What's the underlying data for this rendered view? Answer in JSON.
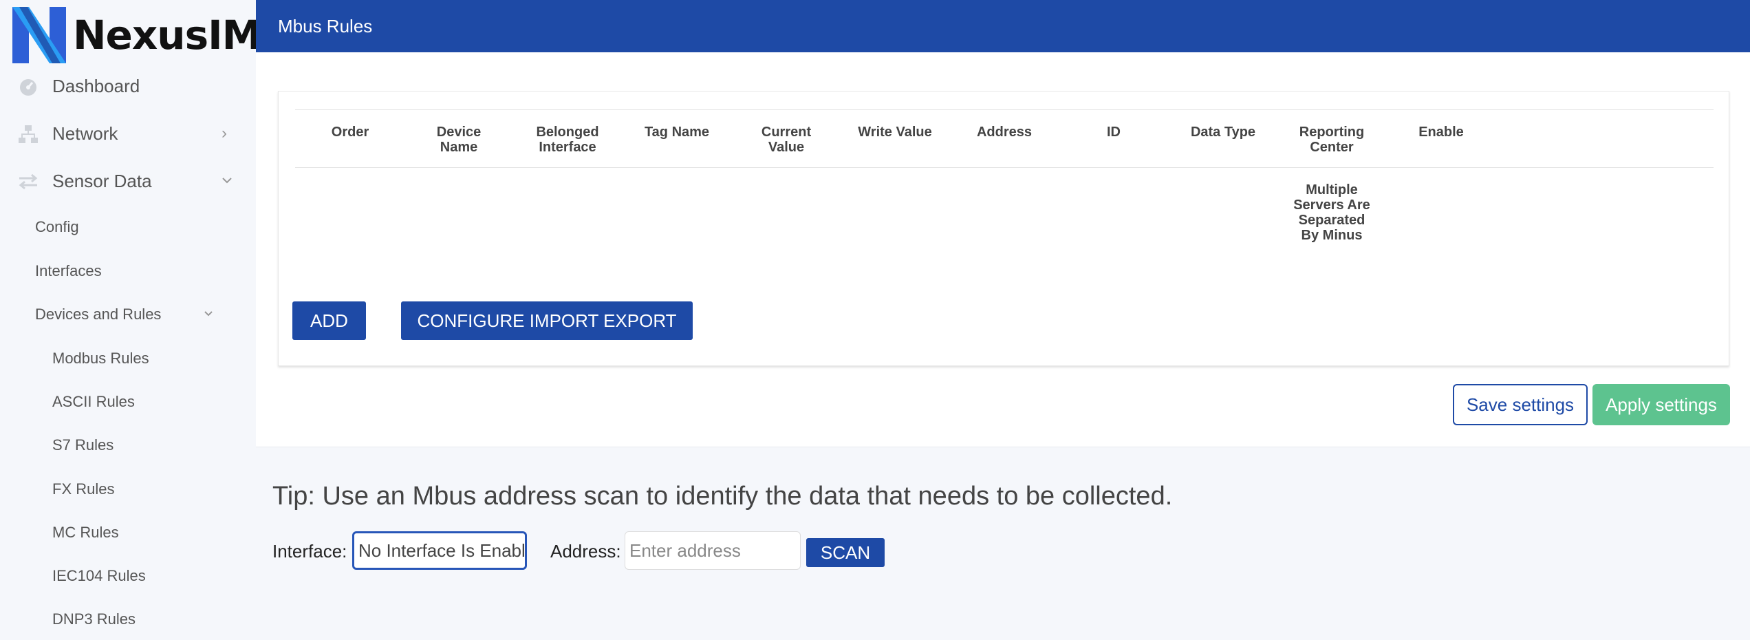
{
  "brand": {
    "name": "NexusIM"
  },
  "sidebar": {
    "items": [
      {
        "label": "Dashboard",
        "icon": "dashboard-icon"
      },
      {
        "label": "Network",
        "icon": "network-icon"
      },
      {
        "label": "Sensor Data",
        "icon": "arrows-icon"
      }
    ],
    "sensor_sub": [
      {
        "label": "Config"
      },
      {
        "label": "Interfaces"
      },
      {
        "label": "Devices and Rules"
      }
    ],
    "rules": [
      {
        "label": "Modbus Rules"
      },
      {
        "label": "ASCII Rules"
      },
      {
        "label": "S7 Rules"
      },
      {
        "label": "FX Rules"
      },
      {
        "label": "MC Rules"
      },
      {
        "label": "IEC104 Rules"
      },
      {
        "label": "DNP3 Rules"
      }
    ]
  },
  "header": {
    "title": "Mbus Rules"
  },
  "table": {
    "columns": [
      {
        "line1": "Order",
        "line2": ""
      },
      {
        "line1": "Device",
        "line2": "Name"
      },
      {
        "line1": "Belonged",
        "line2": "Interface"
      },
      {
        "line1": "Tag Name",
        "line2": ""
      },
      {
        "line1": "Current",
        "line2": "Value"
      },
      {
        "line1": "Write Value",
        "line2": ""
      },
      {
        "line1": "Address",
        "line2": ""
      },
      {
        "line1": "ID",
        "line2": ""
      },
      {
        "line1": "Data Type",
        "line2": ""
      },
      {
        "line1": "Reporting",
        "line2": "Center"
      },
      {
        "line1": "Enable",
        "line2": ""
      }
    ],
    "note_lines": [
      "Multiple",
      "Servers Are",
      "Separated",
      "By Minus"
    ]
  },
  "actions": {
    "add": "ADD",
    "configure": "CONFIGURE IMPORT EXPORT",
    "save": "Save settings",
    "apply": "Apply settings"
  },
  "tip": {
    "text": "Tip: Use an Mbus address scan to identify the data that needs to be collected.",
    "interface_label": "Interface:",
    "interface_value": "No Interface Is Enabled",
    "address_label": "Address:",
    "address_placeholder": "Enter address",
    "scan": "SCAN"
  },
  "colors": {
    "primary": "#1e4aa6",
    "apply": "#5dc38f",
    "background": "#f5f7fb"
  }
}
